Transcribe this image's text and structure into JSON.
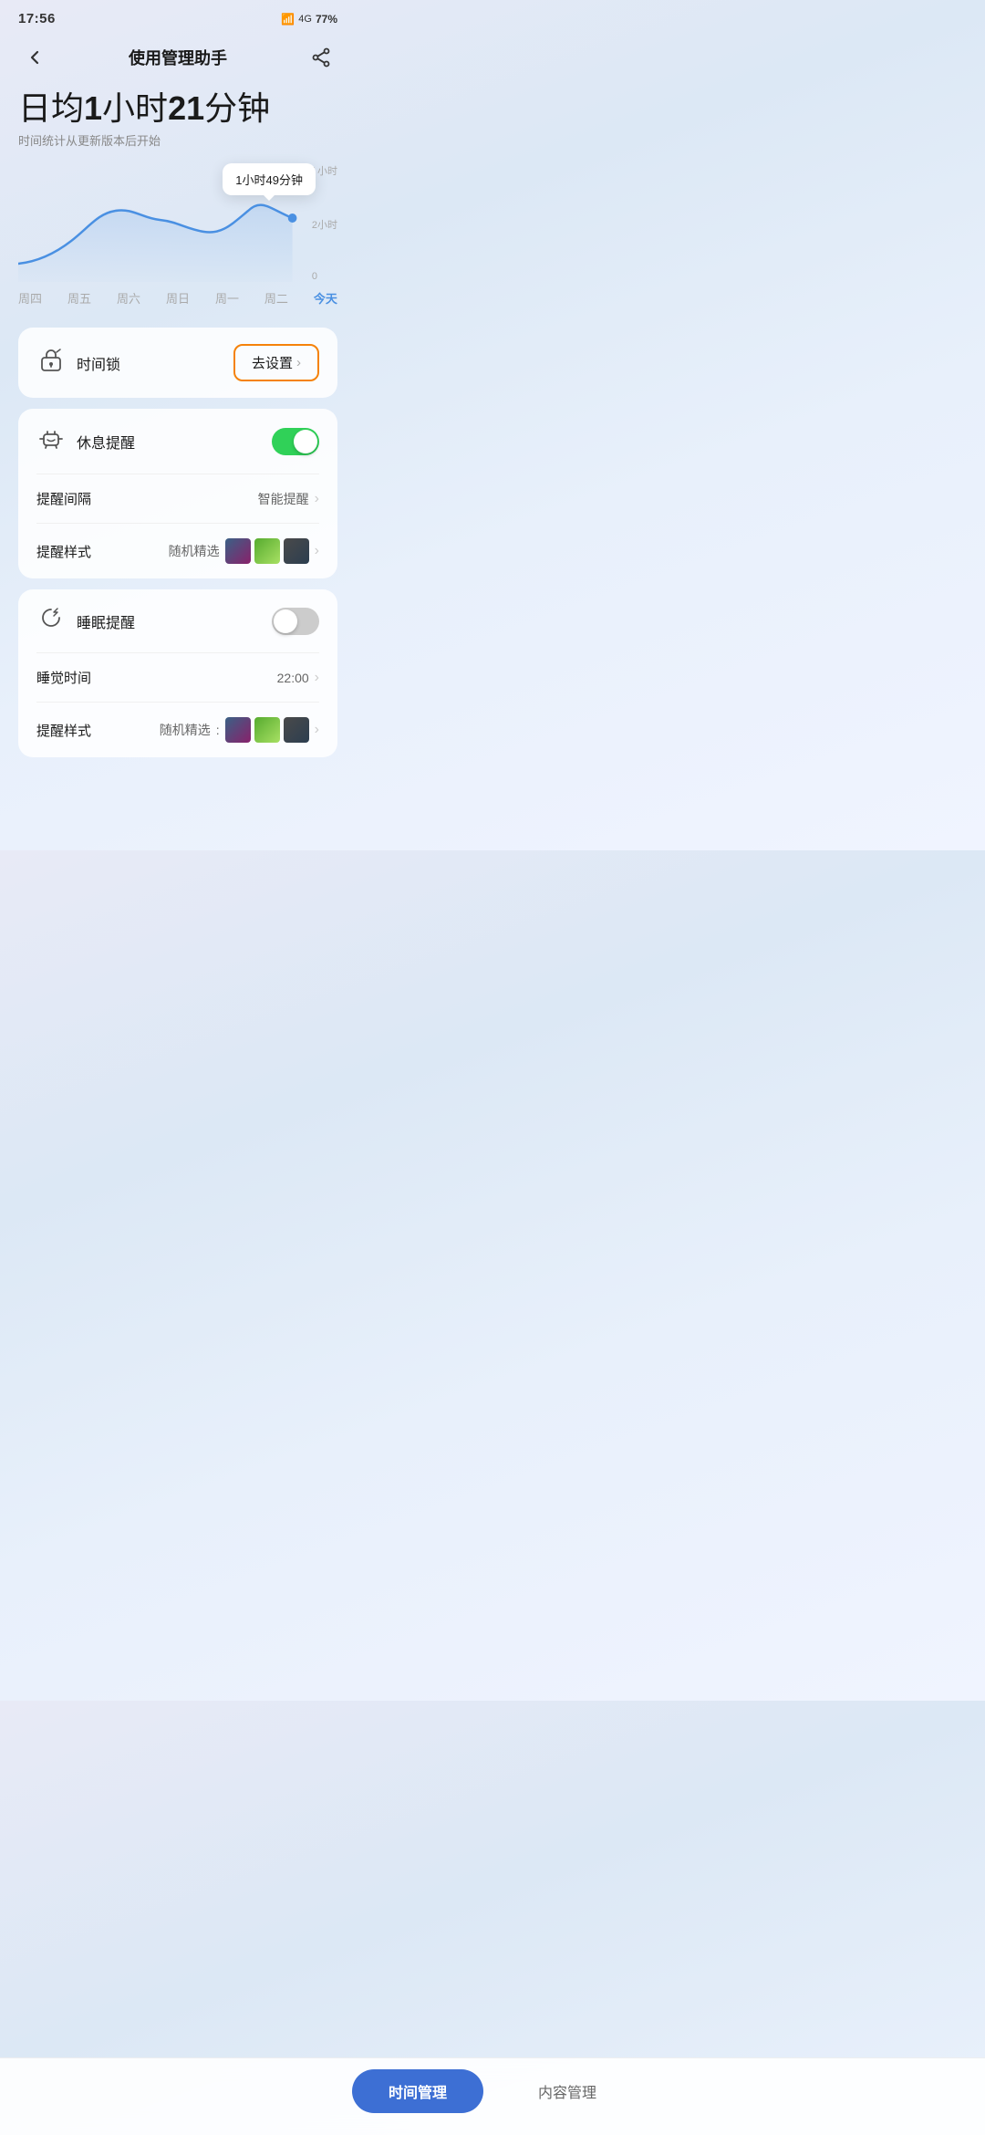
{
  "statusBar": {
    "time": "17:56",
    "battery": "77%"
  },
  "header": {
    "title": "使用管理助手",
    "backLabel": "返回",
    "shareLabel": "分享"
  },
  "dailyAvg": {
    "label1": "日均",
    "num1": "1",
    "label2": "小时",
    "num2": "21",
    "label3": "分钟",
    "subtitle": "时间统计从更新版本后开始"
  },
  "chart": {
    "tooltip": "1小时49分钟",
    "yLabels": [
      "/ 小时",
      "2小时",
      "0"
    ],
    "xLabels": [
      "周四",
      "周五",
      "周六",
      "周日",
      "周一",
      "周二",
      "今天"
    ]
  },
  "timeLockCard": {
    "icon": "⏰",
    "label": "时间锁",
    "btnLabel": "去设置",
    "chevron": ">"
  },
  "restReminderCard": {
    "icon": "☕",
    "label": "休息提醒",
    "toggleState": "on",
    "intervalLabel": "提醒间隔",
    "intervalValue": "智能提醒",
    "styleLabel": "提醒样式",
    "styleValue": "随机精选"
  },
  "sleepReminderCard": {
    "icon": "🌙",
    "label": "睡眠提醒",
    "toggleState": "off",
    "sleepTimeLabel": "睡觉时间",
    "sleepTimeValue": "22:00",
    "styleLabel": "提醒样式",
    "styleValue": "随机精选"
  },
  "bottomTabs": {
    "activeTab": "时间管理",
    "inactiveTab": "内容管理"
  }
}
